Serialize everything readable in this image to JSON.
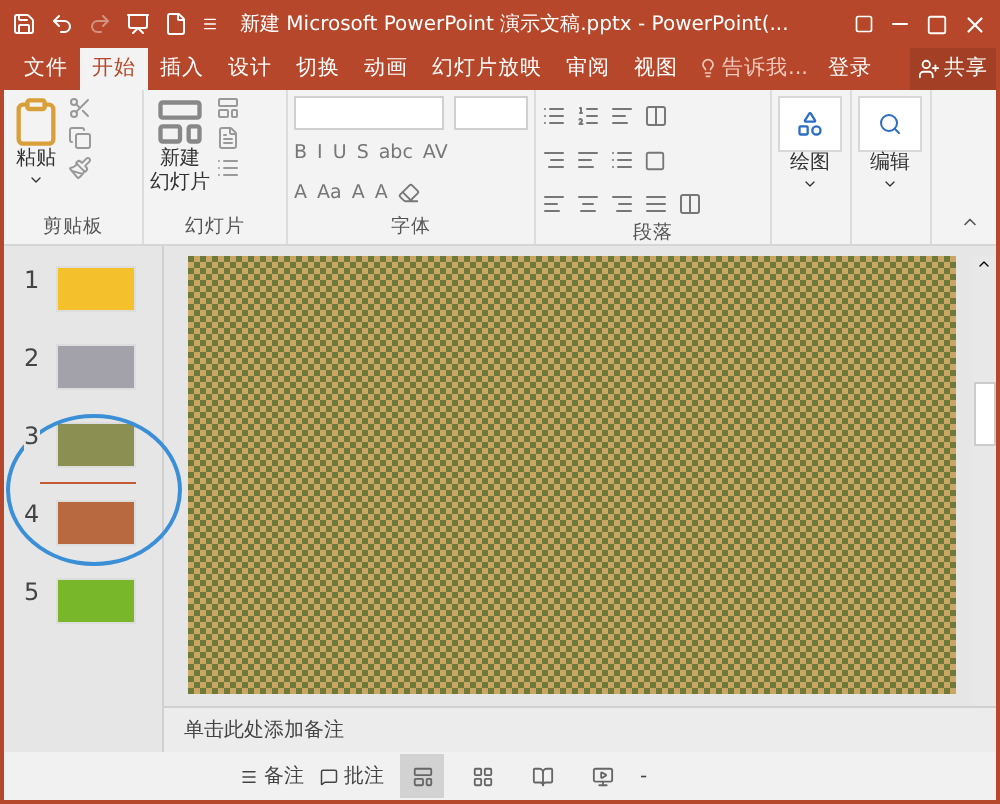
{
  "title_bar": {
    "title": "新建 Microsoft PowerPoint 演示文稿.pptx - PowerPoint(...",
    "redo": {
      "disabled": true
    }
  },
  "tabs": [
    {
      "label": "文件",
      "selected": false
    },
    {
      "label": "开始",
      "selected": true
    },
    {
      "label": "插入",
      "selected": false
    },
    {
      "label": "设计",
      "selected": false
    },
    {
      "label": "切换",
      "selected": false
    },
    {
      "label": "动画",
      "selected": false
    },
    {
      "label": "幻灯片放映",
      "selected": false
    },
    {
      "label": "审阅",
      "selected": false
    },
    {
      "label": "视图",
      "selected": false
    }
  ],
  "tell_me": {
    "placeholder": "告诉我..."
  },
  "sign_in": "登录",
  "share": "共享",
  "ribbon": {
    "clipboard": {
      "label": "剪贴板",
      "paste": "粘贴"
    },
    "slides": {
      "label": "幻灯片",
      "new_slide": "新建",
      "new_slide_2": "幻灯片"
    },
    "font": {
      "label": "字体",
      "row_1": [
        "B",
        "I",
        "U",
        "S",
        "abc",
        "AV"
      ],
      "row_2": [
        "A",
        "Aa",
        "A",
        "A"
      ]
    },
    "paragraph": {
      "label": "段落"
    },
    "drawing": {
      "label": "绘图"
    },
    "editing": {
      "label": "编辑"
    }
  },
  "slides": [
    {
      "number": "1",
      "color": "#f4c12c",
      "drop_before": false
    },
    {
      "number": "2",
      "color": "#a3a2ab",
      "drop_before": false
    },
    {
      "number": "3",
      "color": "#8c8f52",
      "drop_before": false
    },
    {
      "number": "4",
      "color": "#b9693f",
      "drop_before": true
    },
    {
      "number": "5",
      "color": "#78b62a",
      "drop_before": false
    }
  ],
  "notes": {
    "placeholder": "单击此处添加备注"
  },
  "status_bar": {
    "notes": "备注",
    "comments": "批注",
    "views": [
      {
        "kind": "normal",
        "selected": true
      },
      {
        "kind": "sorter",
        "selected": false
      },
      {
        "kind": "reading",
        "selected": false
      },
      {
        "kind": "show",
        "selected": false
      }
    ],
    "zoom_out": "-"
  }
}
